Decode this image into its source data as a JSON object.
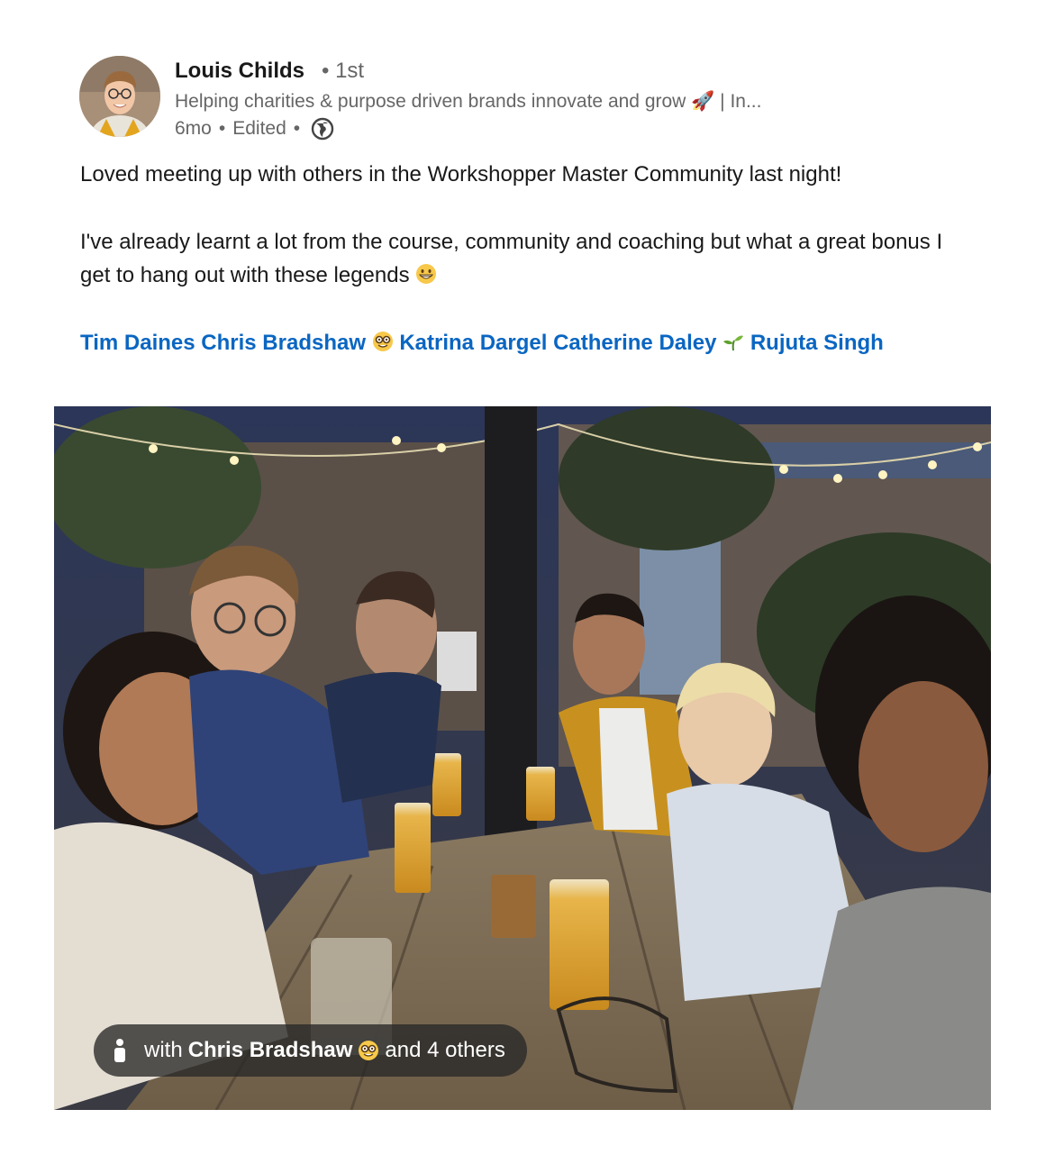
{
  "author": {
    "name": "Louis Childs",
    "degree": "• 1st",
    "headline": "Helping charities & purpose driven brands innovate and grow 🚀 | In...",
    "time": "6mo",
    "edited": "Edited",
    "sep": "•",
    "visibility_icon": "globe-icon"
  },
  "post": {
    "line1": "Loved meeting up with others in the Workshopper Master Community last night!",
    "line2": "I've already learnt a lot from the course, community and coaching but what a great bonus I get to hang out with these legends",
    "line2_emoji": "grinning-face-emoji"
  },
  "mentions": {
    "tim": "Tim Daines",
    "chris": "Chris Bradshaw",
    "chris_emoji": "nerd-face-emoji",
    "katrina": "Katrina Dargel",
    "catherine": "Catherine Daley",
    "catherine_emoji": "seedling-emoji",
    "rujuta": "Rujuta Singh"
  },
  "photo_tag": {
    "prefix": "with",
    "name": "Chris Bradshaw",
    "emoji": "nerd-face-emoji",
    "suffix": "and 4 others",
    "icon": "person-icon"
  },
  "colors": {
    "link": "#0a66c2",
    "text": "#191919",
    "muted": "#666666"
  }
}
